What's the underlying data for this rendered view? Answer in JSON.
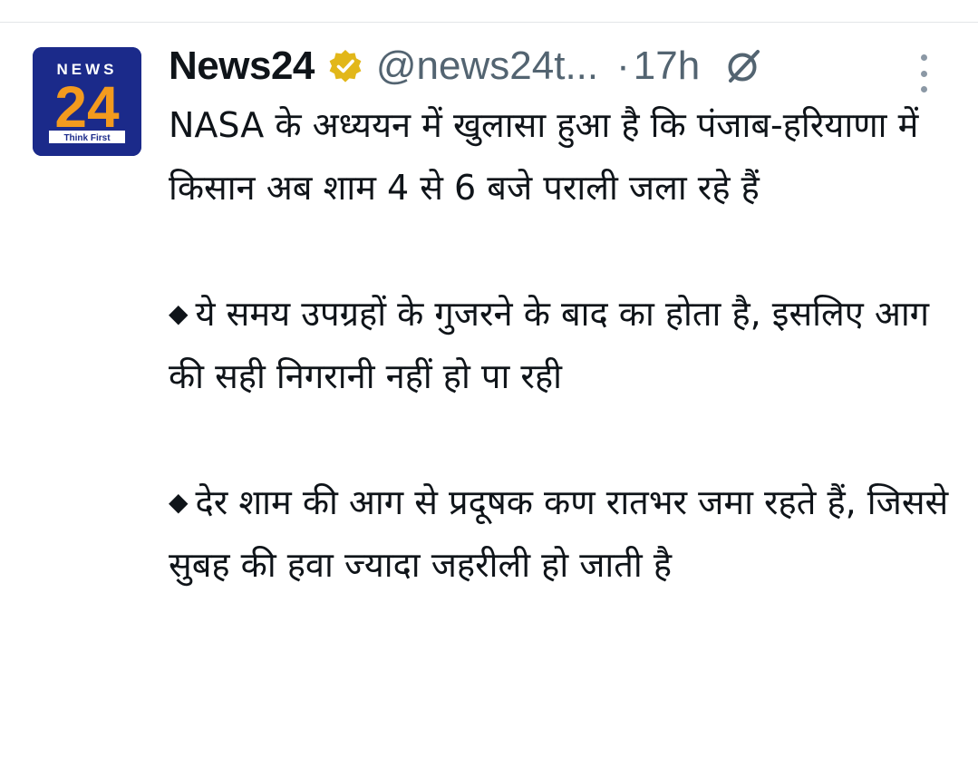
{
  "tweet": {
    "author": {
      "display_name": "News24",
      "handle": "@news24t...",
      "verified": true,
      "verified_badge_color": "#e2b719",
      "avatar": {
        "logo_top": "NEWS",
        "logo_number": "24",
        "logo_tagline": "Think First",
        "brand_colors": {
          "navy": "#1b2a8a",
          "orange": "#f39a1e"
        }
      }
    },
    "separator": "·",
    "time": "17h",
    "grok_icon": "grok-icon",
    "more_icon": "more-vertical-icon",
    "body": {
      "intro": "NASA के अध्ययन में खुलासा हुआ है कि पंजाब-हरियाणा में किसान अब शाम 4 से 6 बजे पराली जला रहे हैं",
      "bullet_symbol": "◆",
      "bullets": [
        "ये समय उपग्रहों के गुजरने के बाद का होता है, इसलिए आग की सही निगरानी नहीं हो पा रही",
        "देर शाम की आग से प्रदूषक कण रातभर जमा रहते हैं, जिससे सुबह की हवा ज्यादा जहरीली हो जाती है"
      ]
    }
  }
}
